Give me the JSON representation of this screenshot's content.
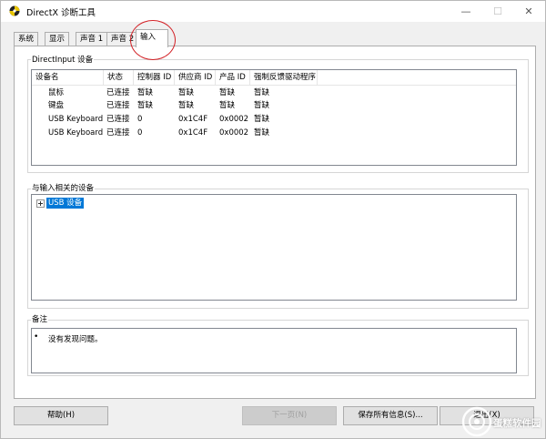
{
  "window": {
    "title": "DirectX 诊断工具",
    "controls": {
      "minimize": "—",
      "maximize": "☐",
      "close": "✕"
    }
  },
  "tabs": [
    {
      "label": "系统"
    },
    {
      "label": "显示"
    },
    {
      "label": "声音 1"
    },
    {
      "label": "声音 2"
    },
    {
      "label": "输入",
      "active": true
    }
  ],
  "directinput": {
    "group_title": "DirectInput 设备",
    "columns": [
      "设备名",
      "状态",
      "控制器 ID",
      "供应商 ID",
      "产品 ID",
      "强制反馈驱动程序"
    ],
    "rows": [
      [
        "鼠标",
        "已连接",
        "暂缺",
        "暂缺",
        "暂缺",
        "暂缺"
      ],
      [
        "键盘",
        "已连接",
        "暂缺",
        "暂缺",
        "暂缺",
        "暂缺"
      ],
      [
        "USB Keyboard",
        "已连接",
        "0",
        "0x1C4F",
        "0x0002",
        "暂缺"
      ],
      [
        "USB Keyboard",
        "已连接",
        "0",
        "0x1C4F",
        "0x0002",
        "暂缺"
      ]
    ]
  },
  "related": {
    "group_title": "与输入相关的设备",
    "tree": [
      {
        "label": "USB 设备",
        "selected": true,
        "collapsed": true
      }
    ]
  },
  "notes": {
    "group_title": "备注",
    "bullet": "•",
    "items": [
      "没有发现问题。"
    ]
  },
  "buttons": {
    "help": "帮助(H)",
    "next": "下一页(N)",
    "save": "保存所有信息(S)...",
    "exit": "退出(X)"
  },
  "watermark": "蛋糕软件园",
  "colors": {
    "selection": "#0078d7",
    "highlight_circle": "#d21f24"
  }
}
